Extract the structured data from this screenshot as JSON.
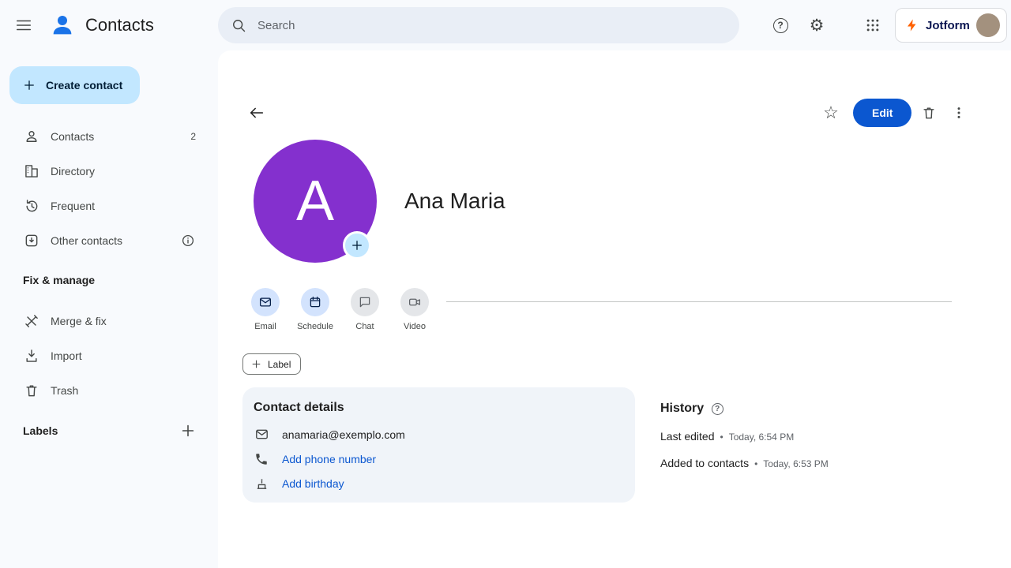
{
  "topbar": {
    "title": "Contacts",
    "search_placeholder": "Search",
    "account_name": "Jotform"
  },
  "icons": {
    "help_glyph": "?",
    "gear_glyph": "⚙",
    "star_glyph": "☆"
  },
  "sidebar": {
    "create_label": "Create contact",
    "items": [
      {
        "label": "Contacts",
        "count": "2"
      },
      {
        "label": "Directory"
      },
      {
        "label": "Frequent"
      },
      {
        "label": "Other contacts"
      }
    ],
    "fix_section": "Fix & manage",
    "fix_items": [
      {
        "label": "Merge & fix"
      },
      {
        "label": "Import"
      },
      {
        "label": "Trash"
      }
    ],
    "labels_title": "Labels"
  },
  "contact": {
    "initial": "A",
    "name": "Ana Maria",
    "toolbar": {
      "edit_label": "Edit"
    },
    "actions": [
      {
        "label": "Email",
        "state": "enabled"
      },
      {
        "label": "Schedule",
        "state": "enabled"
      },
      {
        "label": "Chat",
        "state": "disabled"
      },
      {
        "label": "Video",
        "state": "disabled"
      }
    ],
    "label_chip": "Label",
    "details": {
      "title": "Contact details",
      "email": "anamaria@exemplo.com",
      "add_phone": "Add phone number",
      "add_birthday": "Add birthday"
    },
    "history": {
      "title": "History",
      "separator": "•",
      "entries": [
        {
          "label": "Last edited",
          "time": "Today, 6:54 PM"
        },
        {
          "label": "Added to contacts",
          "time": "Today, 6:53 PM"
        }
      ]
    }
  },
  "colors": {
    "accent_blue": "#0b57d0",
    "create_button_bg": "#c2e7ff",
    "avatar_purple": "#8430ce",
    "action_enabled_bg": "#d3e3fd",
    "action_disabled_bg": "#e4e6e9",
    "details_card_bg": "#f0f4f9",
    "surface_bg": "#f8fafd"
  }
}
